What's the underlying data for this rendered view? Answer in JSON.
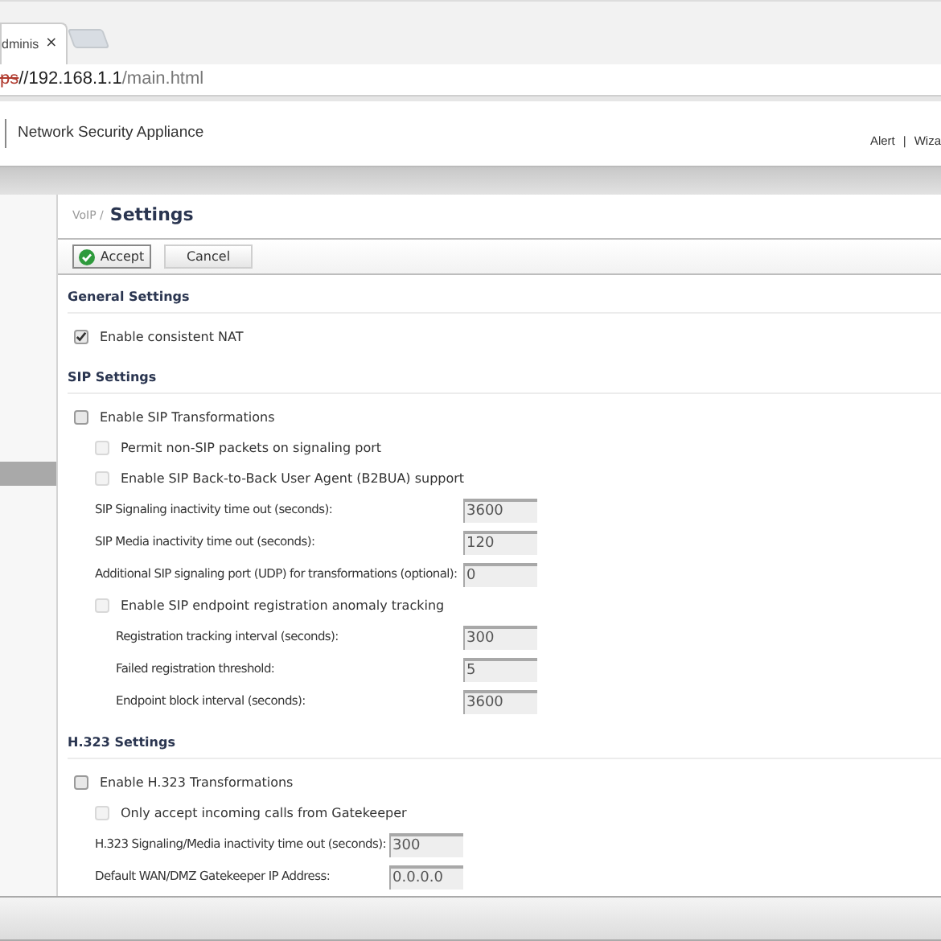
{
  "browser": {
    "tab": {
      "title": "dminis",
      "close": "×"
    },
    "address": {
      "scheme": "ps",
      "host": "//192.168.1.1",
      "path": "/main.html"
    }
  },
  "header": {
    "product": "Network Security Appliance",
    "links": [
      {
        "label": "Alert"
      },
      {
        "label": "Wiza"
      }
    ],
    "separator": "|"
  },
  "sidebar": {
    "items": [
      {
        "selected": true
      }
    ]
  },
  "breadcrumb": {
    "parent": "VoIP /",
    "title": "Settings"
  },
  "toolbar": {
    "buttons": [
      {
        "label": "Accept",
        "kind": "accept"
      },
      {
        "label": "Cancel",
        "kind": "plain"
      }
    ]
  },
  "sections": [
    {
      "title": "General Settings",
      "items": [
        {
          "kind": "checkbox",
          "label": "Enable consistent NAT",
          "checked": true,
          "disabled": false
        }
      ]
    },
    {
      "title": "SIP Settings",
      "items": [
        {
          "kind": "checkbox",
          "label": "Enable SIP Transformations",
          "checked": false,
          "disabled": false,
          "children": [
            {
              "kind": "checkbox",
              "label": "Permit non-SIP packets on signaling port",
              "checked": false,
              "disabled": true
            },
            {
              "kind": "checkbox",
              "label": "Enable SIP Back-to-Back User Agent (B2BUA) support",
              "checked": false,
              "disabled": true
            },
            {
              "kind": "field",
              "label": "SIP Signaling inactivity time out (seconds):",
              "value": "3600"
            },
            {
              "kind": "field",
              "label": "SIP Media inactivity time out (seconds):",
              "value": "120"
            },
            {
              "kind": "field",
              "label": "Additional SIP signaling port (UDP) for transformations (optional):",
              "value": "0"
            },
            {
              "kind": "checkbox",
              "label": "Enable SIP endpoint registration anomaly tracking",
              "checked": false,
              "disabled": true,
              "children": [
                {
                  "kind": "field",
                  "label": "Registration tracking interval (seconds):",
                  "value": "300"
                },
                {
                  "kind": "field",
                  "label": "Failed registration threshold:",
                  "value": "5"
                },
                {
                  "kind": "field",
                  "label": "Endpoint block interval (seconds):",
                  "value": "3600"
                }
              ]
            }
          ]
        }
      ]
    },
    {
      "title": "H.323 Settings",
      "items": [
        {
          "kind": "checkbox",
          "label": "Enable H.323 Transformations",
          "checked": false,
          "disabled": false,
          "children": [
            {
              "kind": "checkbox",
              "label": "Only accept incoming calls from Gatekeeper",
              "checked": false,
              "disabled": true
            },
            {
              "kind": "field",
              "label": "H.323 Signaling/Media inactivity time out (seconds):",
              "value": "300"
            },
            {
              "kind": "field",
              "label": "Default WAN/DMZ Gatekeeper IP Address:",
              "value": "0.0.0.0"
            }
          ]
        }
      ]
    }
  ]
}
